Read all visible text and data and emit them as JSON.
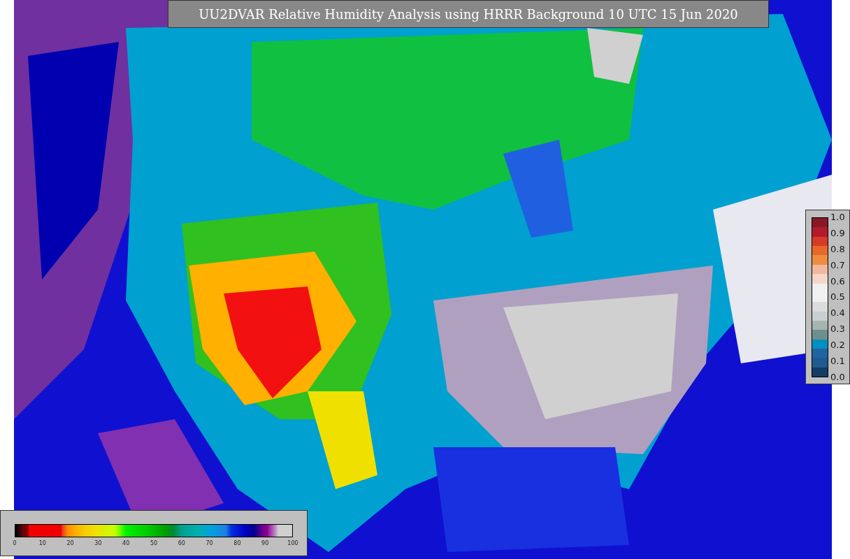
{
  "title": "UU2DVAR Relative Humidity Analysis using HRRR Background 10 UTC 15 Jun 2020",
  "humidity_legend": {
    "ticks": [
      "0",
      "10",
      "20",
      "30",
      "40",
      "50",
      "60",
      "70",
      "80",
      "90",
      "100"
    ]
  },
  "fraction_legend": {
    "ticks": [
      "1.0",
      "0.9",
      "0.8",
      "0.7",
      "0.6",
      "0.5",
      "0.4",
      "0.3",
      "0.2",
      "0.1",
      "0.0"
    ]
  }
}
